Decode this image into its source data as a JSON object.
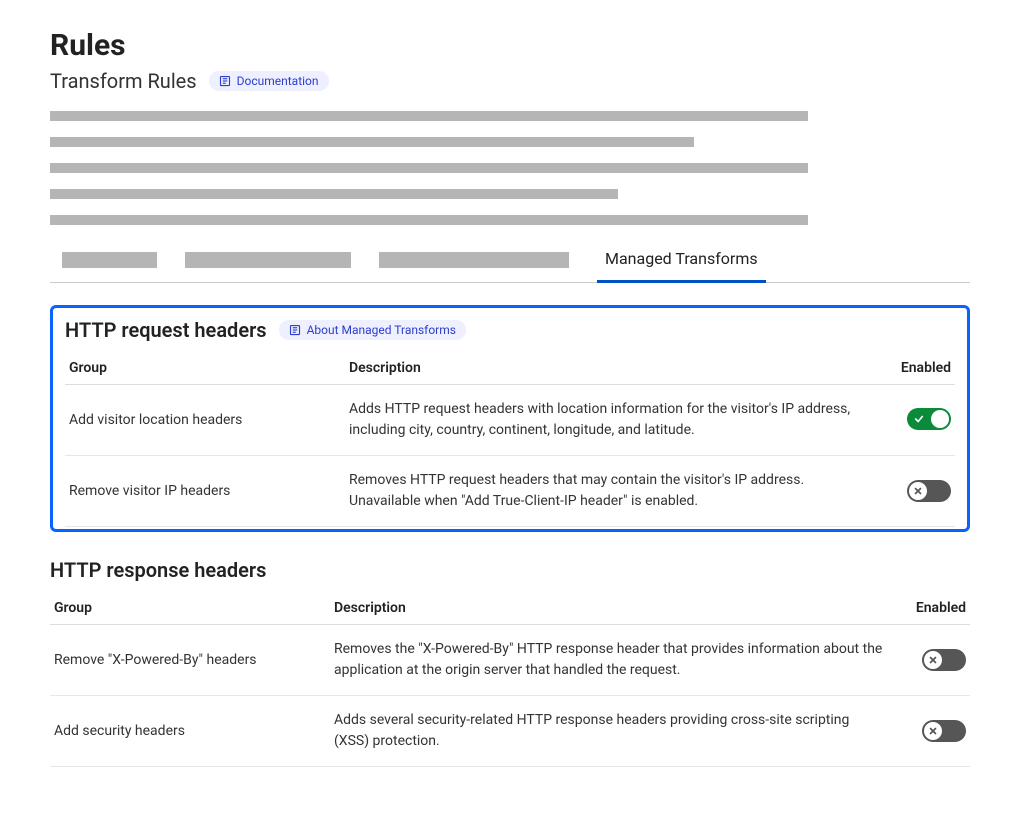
{
  "page": {
    "title": "Rules",
    "subtitle": "Transform Rules",
    "doc_label": "Documentation"
  },
  "tabs": {
    "active": "Managed Transforms"
  },
  "headers": {
    "group": "Group",
    "description": "Description",
    "enabled": "Enabled"
  },
  "request_section": {
    "title": "HTTP request headers",
    "about_label": "About Managed Transforms",
    "rows": [
      {
        "group": "Add visitor location headers",
        "desc": "Adds HTTP request headers with location information for the visitor's IP address, including city, country, continent, longitude, and latitude.",
        "enabled": true
      },
      {
        "group": "Remove visitor IP headers",
        "desc": "Removes HTTP request headers that may contain the visitor's IP address. Unavailable when \"Add True-Client-IP header\" is enabled.",
        "enabled": false
      }
    ]
  },
  "response_section": {
    "title": "HTTP response headers",
    "rows": [
      {
        "group": "Remove \"X-Powered-By\" headers",
        "desc": "Removes the \"X-Powered-By\" HTTP response header that provides information about the application at the origin server that handled the request.",
        "enabled": false
      },
      {
        "group": "Add security headers",
        "desc": "Adds several security-related HTTP response headers providing cross-site scripting (XSS) protection.",
        "enabled": false
      }
    ]
  }
}
